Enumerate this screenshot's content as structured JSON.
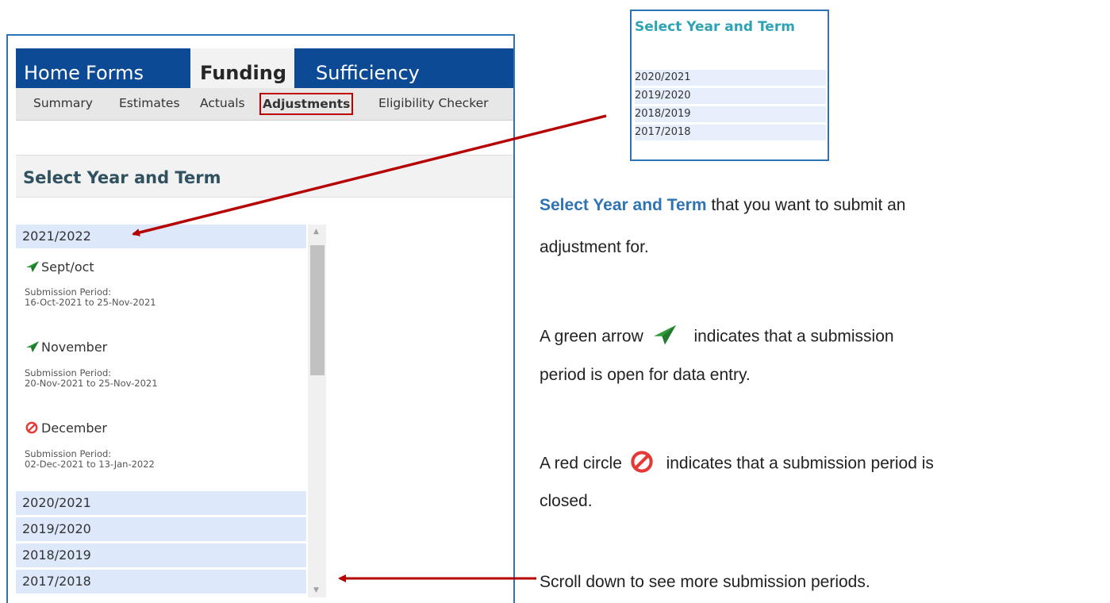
{
  "nav": {
    "tabs": [
      "Home",
      "Forms",
      "Funding",
      "Sufficiency"
    ],
    "subtabs": [
      "Summary",
      "Estimates",
      "Actuals",
      "Adjustments",
      "Eligibility Checker"
    ]
  },
  "section_title": "Select Year and Term",
  "years": {
    "y2021": "2021/2022",
    "y2020": "2020/2021",
    "y2019": "2019/2020",
    "y2018": "2018/2019",
    "y2017": "2017/2018"
  },
  "terms": [
    {
      "name": "Sept/oct",
      "status": "open",
      "label": "Submission Period:",
      "range": "16-Oct-2021 to 25-Nov-2021"
    },
    {
      "name": "November",
      "status": "open",
      "label": "Submission Period:",
      "range": "20-Nov-2021 to 25-Nov-2021"
    },
    {
      "name": "December",
      "status": "closed",
      "label": "Submission Period:",
      "range": "02-Dec-2021 to 13-Jan-2022"
    }
  ],
  "inset": {
    "title": "Select Year and Term",
    "rows": [
      "2020/2021",
      "2019/2020",
      "2018/2019",
      "2017/2018"
    ]
  },
  "instructions": {
    "p1_bold": "Select Year and Term",
    "p1_rest": " that you want to submit an",
    "p1_line2": "adjustment for.",
    "p2_a": "A green arrow",
    "p2_b": "indicates that a submission",
    "p2_line2": "period is open for data entry.",
    "p3_a": "A red circle",
    "p3_b": "indicates that a submission period is",
    "p3_line2": "closed.",
    "p4": "Scroll down to see more submission periods."
  },
  "colors": {
    "nav_bg": "#0c4a96",
    "year_row_bg": "#dde8fb",
    "open_icon": "#2e9a3a",
    "closed_icon": "#e53935",
    "callout_arrow": "#b50000",
    "accent_blue": "#2e74b5"
  },
  "icons": {
    "open": "paper-plane-icon",
    "closed": "no-entry-icon"
  }
}
